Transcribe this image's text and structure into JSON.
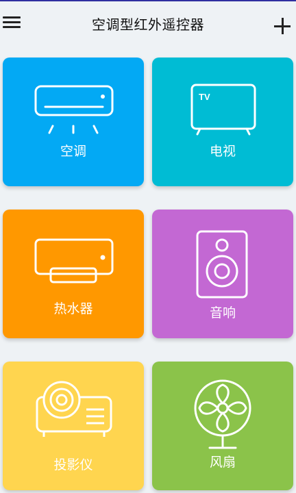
{
  "header": {
    "title": "空调型红外遥控器",
    "menu_icon": "menu-icon",
    "add_icon": "plus-icon"
  },
  "tiles": [
    {
      "label": "空调",
      "color": "#03A9F4",
      "icon": "air-conditioner-icon"
    },
    {
      "label": "电视",
      "color": "#00BCD4",
      "icon": "tv-icon"
    },
    {
      "label": "热水器",
      "color": "#FF9800",
      "icon": "water-heater-icon"
    },
    {
      "label": "音响",
      "color": "#C368D3",
      "icon": "speaker-icon"
    },
    {
      "label": "投影仪",
      "color": "#FFD54F",
      "icon": "projector-icon"
    },
    {
      "label": "风扇",
      "color": "#8BC34A",
      "icon": "fan-icon"
    }
  ],
  "tv_icon_text": "TV"
}
